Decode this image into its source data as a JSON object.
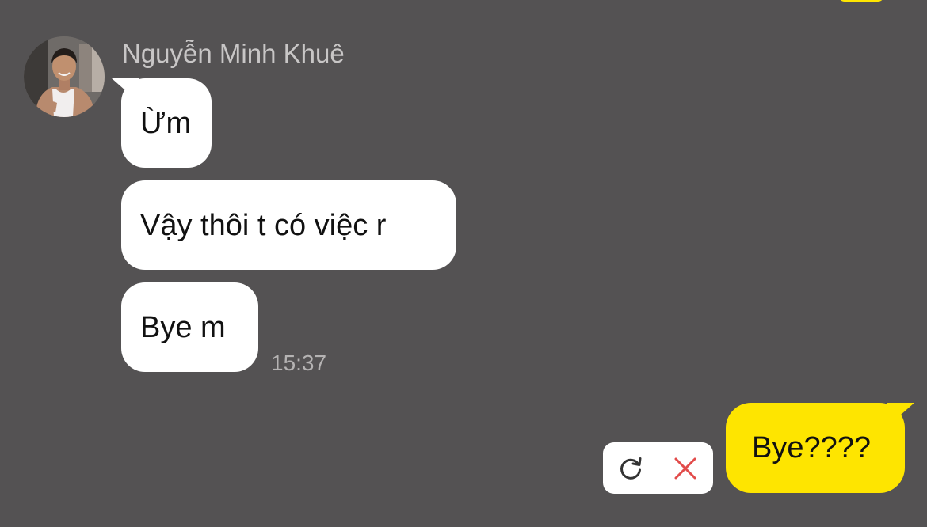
{
  "sender": {
    "name": "Nguyễn Minh Khuê"
  },
  "incoming_messages": [
    {
      "text": "Ừm"
    },
    {
      "text": "Vậy thôi t có việc r"
    },
    {
      "text": "Bye m"
    }
  ],
  "incoming_time": "15:37",
  "outgoing_message": {
    "text": "Bye????",
    "status": "failed"
  },
  "failed_actions": {
    "retry_icon": "refresh-icon",
    "delete_icon": "close-icon"
  },
  "colors": {
    "background": "#545253",
    "incoming_bubble": "#ffffff",
    "outgoing_bubble": "#fee500",
    "delete_icon": "#e24c4b",
    "retry_icon": "#333333"
  }
}
